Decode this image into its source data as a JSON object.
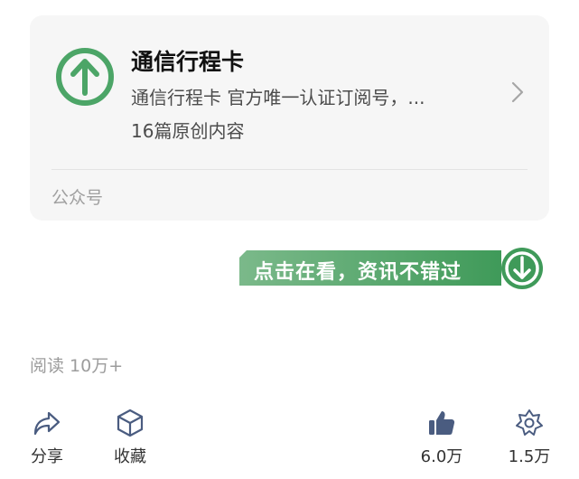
{
  "account_card": {
    "name": "通信行程卡",
    "description": "通信行程卡 官方唯一认证订阅号，...",
    "article_count": "16篇原创内容",
    "type_label": "公众号",
    "icon": "up-arrow-circle-icon",
    "accent_color": "#4ca567"
  },
  "banner": {
    "text": "点击在看，资讯不错过",
    "icon": "down-arrow-circle-icon",
    "color": "#3f9a59"
  },
  "stats": {
    "read_label": "阅读 10万+"
  },
  "toolbar": {
    "share_label": "分享",
    "favorite_label": "收藏",
    "like_count": "6.0万",
    "wow_count": "1.5万",
    "like_color": "#4a5c80"
  }
}
